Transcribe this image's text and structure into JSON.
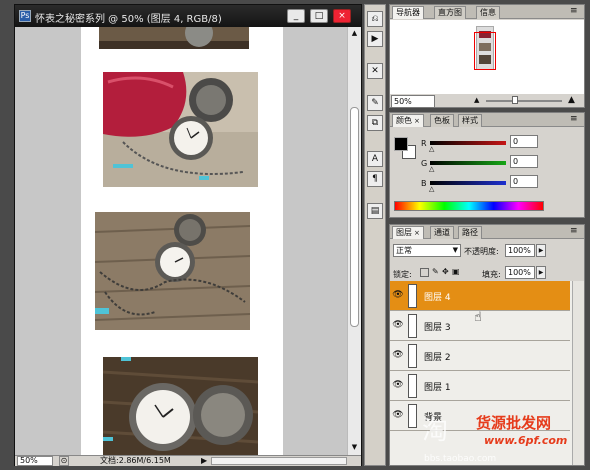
{
  "document": {
    "title": "怀表之秘密系列 @ 50% (图层 4, RGB/8)",
    "app_icon": "Ps",
    "zoom": "50%",
    "doc_info": "文档:2.86M/6.15M",
    "buttons": {
      "minimize": "_",
      "maximize": "□",
      "close": "×"
    }
  },
  "toolstrip": [
    "history-icon",
    "actions-icon",
    "tools-icon",
    "brushes-icon",
    "clone-icon",
    "text-icon",
    "paragraph-icon",
    "layer-comps-icon"
  ],
  "navigator": {
    "tabs": [
      "导航器",
      "直方图",
      "信息"
    ],
    "zoom": "50%"
  },
  "color": {
    "tabs": [
      "颜色",
      "色板",
      "样式"
    ],
    "channels": [
      {
        "label": "R",
        "value": "0",
        "color": "#c51414"
      },
      {
        "label": "G",
        "value": "0",
        "color": "#16a616"
      },
      {
        "label": "B",
        "value": "0",
        "color": "#1d2fcf"
      }
    ]
  },
  "layers": {
    "tabs": [
      "图层",
      "通道",
      "路径"
    ],
    "blend_mode": "正常",
    "opacity_label": "不透明度:",
    "opacity": "100%",
    "lock_label": "锁定:",
    "fill_label": "填充:",
    "fill": "100%",
    "items": [
      {
        "name": "图层 4",
        "selected": true
      },
      {
        "name": "图层 3",
        "selected": false
      },
      {
        "name": "图层 2",
        "selected": false
      },
      {
        "name": "图层 1",
        "selected": false
      },
      {
        "name": "背景",
        "selected": false
      }
    ]
  },
  "watermark": {
    "text1": "淘",
    "text2": "货源批发网",
    "text3": "www.6pf.com",
    "text4": "bbs.taobao.com"
  }
}
